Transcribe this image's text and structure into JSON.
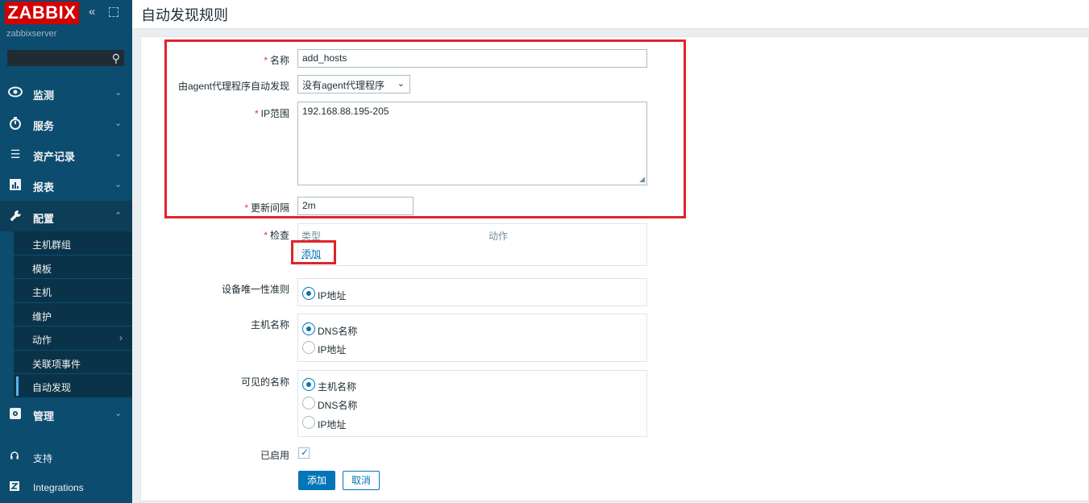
{
  "sidebar": {
    "logo": "ZABBIX",
    "server": "zabbixserver",
    "search_placeholder": "",
    "nav": [
      {
        "label": "监测",
        "icon": "eye-icon"
      },
      {
        "label": "服务",
        "icon": "clock-icon"
      },
      {
        "label": "资产记录",
        "icon": "list-icon"
      },
      {
        "label": "报表",
        "icon": "chart-icon"
      },
      {
        "label": "配置",
        "icon": "wrench-icon"
      },
      {
        "label": "管理",
        "icon": "gear-icon"
      }
    ],
    "config_submenu": [
      "主机群组",
      "模板",
      "主机",
      "维护",
      "动作",
      "关联项事件",
      "自动发现"
    ],
    "bottom": [
      {
        "label": "支持",
        "icon": "headset-icon"
      },
      {
        "label": "Integrations",
        "icon": "integrations-icon"
      }
    ]
  },
  "header": {
    "title": "自动发现规则"
  },
  "form": {
    "name_label": "名称",
    "name_value": "add_hosts",
    "proxy_label": "由agent代理程序自动发现",
    "proxy_value": "没有agent代理程序",
    "iprange_label": "IP范围",
    "iprange_value": "192.168.88.195-205",
    "interval_label": "更新间隔",
    "interval_value": "2m",
    "checks_label": "检查",
    "checks_col_type": "类型",
    "checks_col_action": "动作",
    "checks_add": "添加",
    "uniqueness_label": "设备唯一性准则",
    "uniqueness_options": [
      "IP地址"
    ],
    "hostname_label": "主机名称",
    "hostname_options": [
      "DNS名称",
      "IP地址"
    ],
    "visible_label": "可见的名称",
    "visible_options": [
      "主机名称",
      "DNS名称",
      "IP地址"
    ],
    "enabled_label": "已启用",
    "enabled": true,
    "submit": "添加",
    "cancel": "取消"
  },
  "colors": {
    "sidebar": "#0b4c6f",
    "logo": "#d40000",
    "accent": "#0275b8",
    "highlight": "#e0242b"
  }
}
